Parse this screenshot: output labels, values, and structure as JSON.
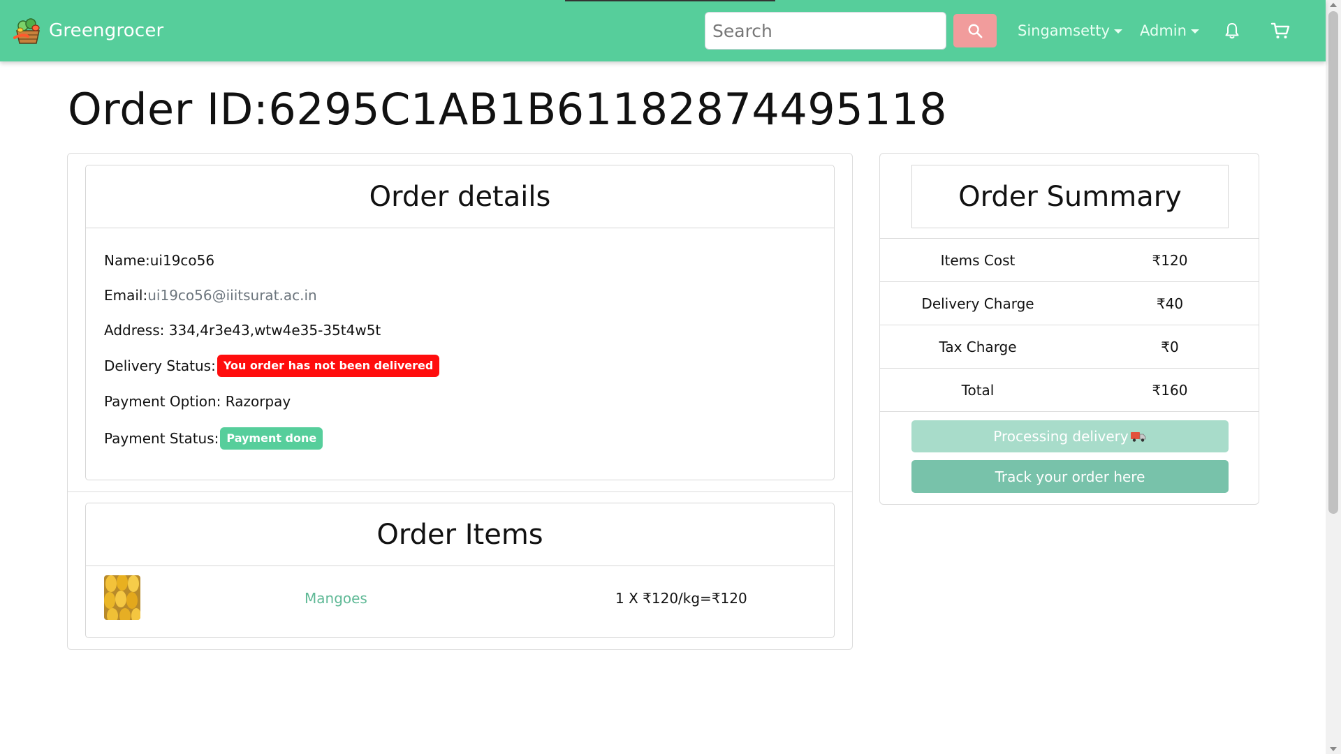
{
  "navbar": {
    "brand": "Greengrocer",
    "search_placeholder": "Search",
    "user_menu": "Singamsetty",
    "admin_menu": "Admin",
    "icons": [
      "search-icon",
      "bell-icon",
      "cart-icon"
    ],
    "color": "#56ce9b"
  },
  "page": {
    "title": "Order ID:6295C1AB1B61182874495118"
  },
  "order_details": {
    "heading": "Order details",
    "name_label": "Name:",
    "name": "ui19co56",
    "email_label": "Email:",
    "email": "ui19co56@iiitsurat.ac.in",
    "address_label": "Address: ",
    "address": "334,4r3e43,wtw4e35-35t4w5t",
    "delivery_status_label": "Delivery Status:",
    "delivery_status": "You order has not been delivered",
    "payment_option_label": "Payment Option: ",
    "payment_option": "Razorpay",
    "payment_status_label": "Payment Status:",
    "payment_status": "Payment done"
  },
  "order_items": {
    "heading": "Order Items",
    "items": [
      {
        "name": "Mangoes",
        "price_text": "1 X ₹120/kg=₹120"
      }
    ]
  },
  "summary": {
    "heading": "Order Summary",
    "rows": [
      {
        "label": "Items Cost",
        "value": "₹120"
      },
      {
        "label": "Delivery Charge",
        "value": "₹40"
      },
      {
        "label": "Tax Charge",
        "value": "₹0"
      },
      {
        "label": "Total",
        "value": "₹160"
      }
    ],
    "processing_label": "Processing delivery",
    "track_label": "Track your order here"
  },
  "colors": {
    "danger": "#ff0d0d",
    "success": "#56ce9b",
    "track_button": "#78c2aa",
    "processing_button": "#a8dcca"
  }
}
